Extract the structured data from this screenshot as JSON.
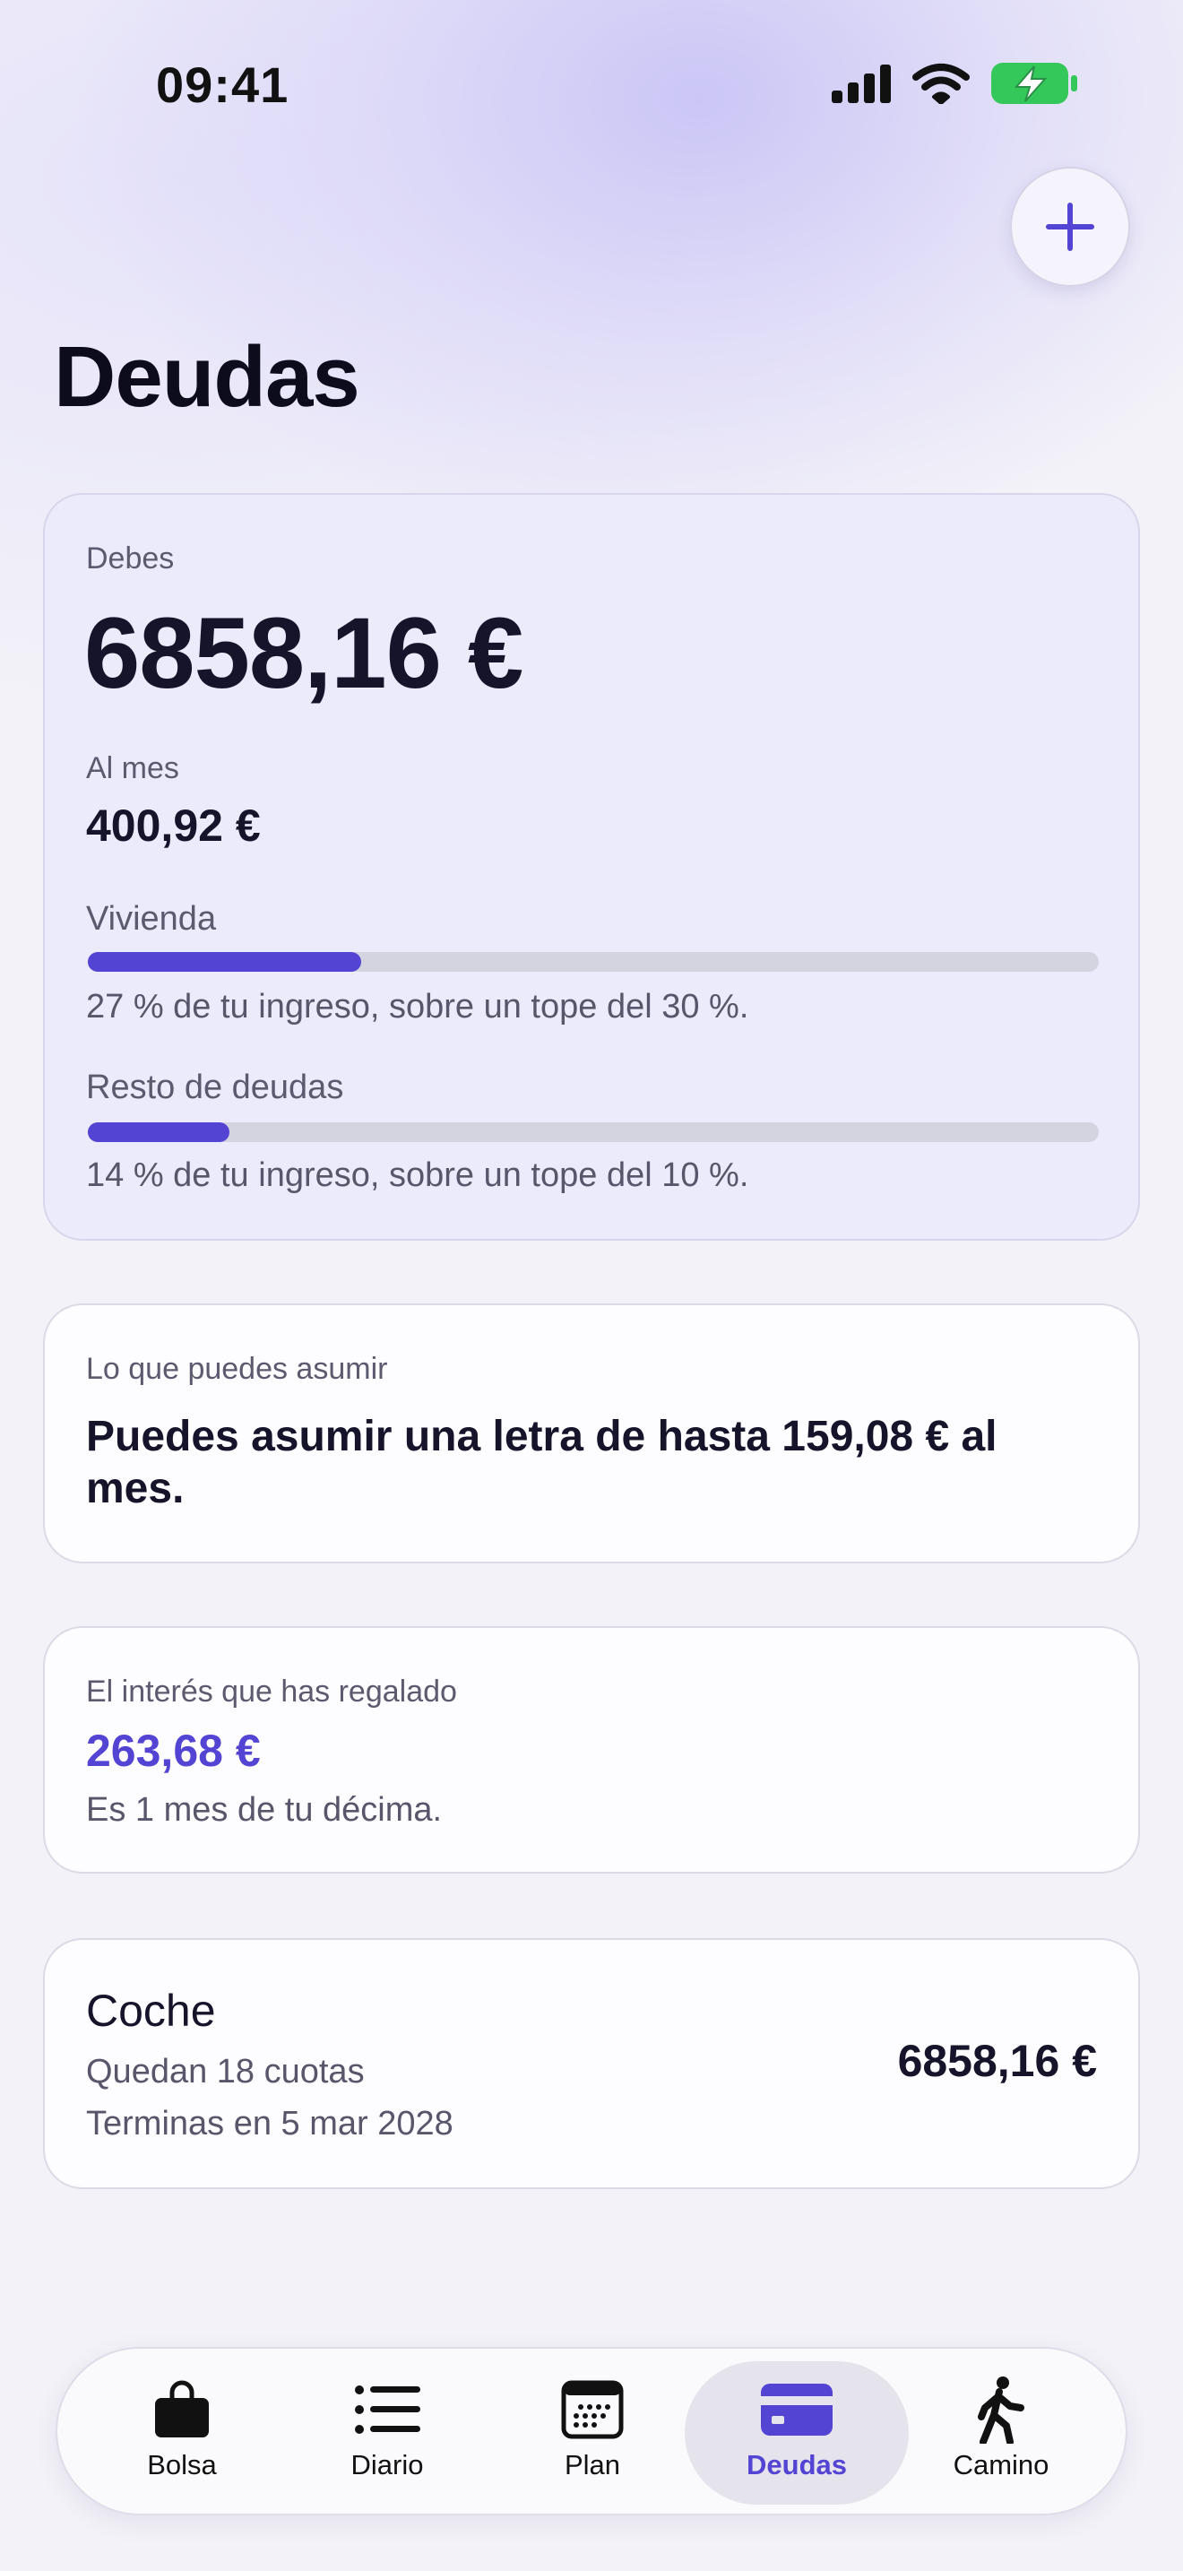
{
  "status": {
    "time": "09:41"
  },
  "header": {
    "title": "Deudas",
    "add_icon": "plus-icon"
  },
  "summary": {
    "owed_label": "Debes",
    "owed_value": "6858,16 €",
    "monthly_label": "Al mes",
    "monthly_value": "400,92 €",
    "housing": {
      "label": "Vivienda",
      "fraction": 0.27,
      "note": "27 % de tu ingreso, sobre un tope del 30 %."
    },
    "other": {
      "label": "Resto de deudas",
      "fraction": 0.14,
      "note": "14 % de tu ingreso, sobre un tope del 10 %."
    }
  },
  "affordable": {
    "label": "Lo que puedes asumir",
    "text": "Puedes asumir una letra de hasta 159,08 € al mes."
  },
  "interest": {
    "label": "El interés que has regalado",
    "value": "263,68 €",
    "note": "Es 1 mes de tu décima."
  },
  "debt": {
    "name": "Coche",
    "remaining": "Quedan 18 cuotas",
    "ends": "Terminas en 5 mar 2028",
    "amount": "6858,16 €"
  },
  "tabs": [
    {
      "label": "Bolsa",
      "icon": "bag-icon"
    },
    {
      "label": "Diario",
      "icon": "list-icon"
    },
    {
      "label": "Plan",
      "icon": "calendar-icon"
    },
    {
      "label": "Deudas",
      "icon": "card-icon",
      "active": true
    },
    {
      "label": "Camino",
      "icon": "walk-icon"
    }
  ],
  "colors": {
    "accent": "#5444d4",
    "text": "#15142a",
    "muted": "#5b5a6e",
    "battery": "#34c759"
  }
}
